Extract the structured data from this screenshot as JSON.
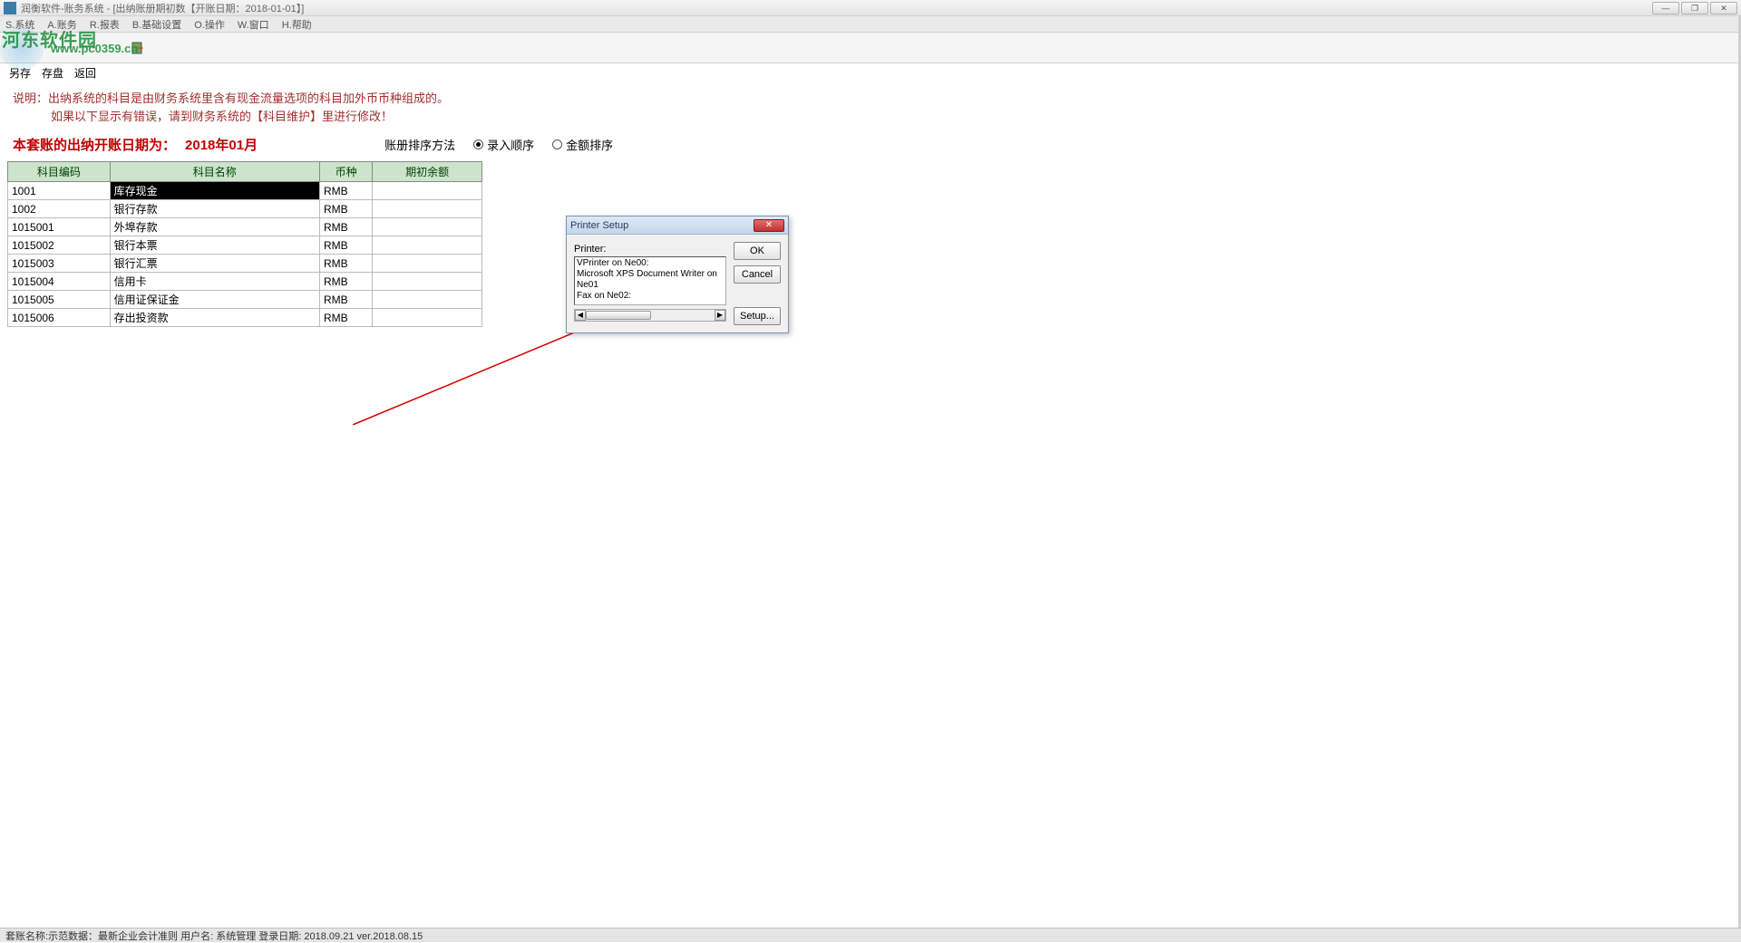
{
  "window": {
    "title": "润衡软件-账务系统 - [出纳账册期初数【开账日期：2018-01-01】]"
  },
  "win_controls": {
    "min": "—",
    "max": "❐",
    "close": "✕",
    "sub_max": "❐",
    "sub_close": "✕"
  },
  "menu": {
    "m1": "S.系统",
    "m2": "A.账务",
    "m3": "R.报表",
    "m4": "B.基础设置",
    "m5": "O.操作",
    "m6": "W.窗口",
    "m7": "H.帮助"
  },
  "watermark": {
    "site": "河东软件园",
    "url": "www.pc0359.cn"
  },
  "actions": {
    "a1": "另存",
    "a2": "存盘",
    "a3": "返回"
  },
  "notes": {
    "line1": "说明：出纳系统的科目是由财务系统里含有现金流量选项的科目加外币币种组成的。",
    "line2": "如果以下显示有错误，请到财务系统的【科目维护】里进行修改！"
  },
  "date_row": {
    "label": "本套账的出纳开账日期为：",
    "value": "2018年01月",
    "sort_label": "账册排序方法",
    "opt1": "录入顺序",
    "opt2": "金额排序"
  },
  "grid": {
    "headers": {
      "h1": "科目编码",
      "h2": "科目名称",
      "h3": "币种",
      "h4": "期初余额"
    },
    "rows": [
      {
        "code": "1001",
        "name": "库存现金",
        "curr": "RMB",
        "bal": ""
      },
      {
        "code": "1002",
        "name": "银行存款",
        "curr": "RMB",
        "bal": ""
      },
      {
        "code": "1015001",
        "name": "外埠存款",
        "curr": "RMB",
        "bal": ""
      },
      {
        "code": "1015002",
        "name": "银行本票",
        "curr": "RMB",
        "bal": ""
      },
      {
        "code": "1015003",
        "name": "银行汇票",
        "curr": "RMB",
        "bal": ""
      },
      {
        "code": "1015004",
        "name": "信用卡",
        "curr": "RMB",
        "bal": ""
      },
      {
        "code": "1015005",
        "name": "信用证保证金",
        "curr": "RMB",
        "bal": ""
      },
      {
        "code": "1015006",
        "name": "存出投资款",
        "curr": "RMB",
        "bal": ""
      }
    ]
  },
  "dialog": {
    "title": "Printer Setup",
    "label": "Printer:",
    "printers": [
      "VPrinter on Ne00:",
      "Microsoft XPS Document Writer on Ne01",
      "Fax on Ne02:"
    ],
    "ok": "OK",
    "cancel": "Cancel",
    "setup": "Setup..."
  },
  "status": "套账名称:示范数据：最新企业会计准则    用户名: 系统管理    登录日期: 2018.09.21   ver.2018.08.15"
}
